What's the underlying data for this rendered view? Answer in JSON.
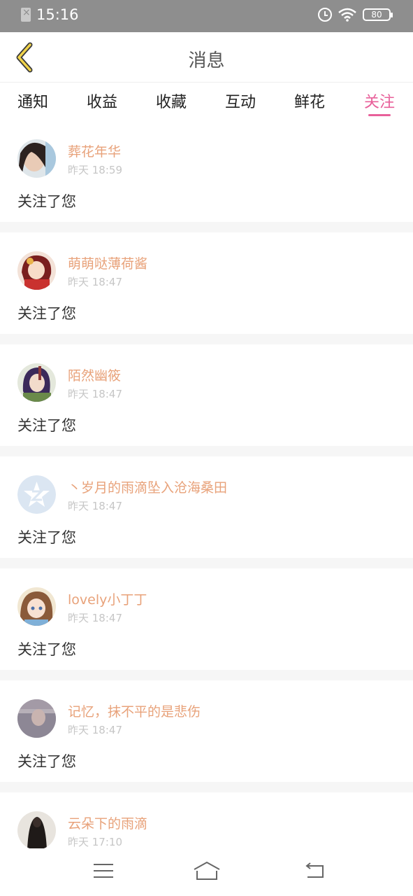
{
  "status_bar": {
    "time": "15:16",
    "battery": "80"
  },
  "header": {
    "title": "消息"
  },
  "tabs": [
    {
      "label": "通知"
    },
    {
      "label": "收益"
    },
    {
      "label": "收藏"
    },
    {
      "label": "互动"
    },
    {
      "label": "鲜花"
    },
    {
      "label": "关注",
      "active": true
    }
  ],
  "messages": [
    {
      "name": "葬花年华",
      "time": "昨天 18:59",
      "text": "关注了您",
      "avatar": "avatar-woman-photo"
    },
    {
      "name": "萌萌哒薄荷酱",
      "time": "昨天 18:47",
      "text": "关注了您",
      "avatar": "avatar-anime-red"
    },
    {
      "name": "陌然幽筱",
      "time": "昨天 18:47",
      "text": "关注了您",
      "avatar": "avatar-anime-purple"
    },
    {
      "name": "丶岁月的雨滴坠入沧海桑田",
      "time": "昨天 18:47",
      "text": "关注了您",
      "avatar": "avatar-default-logo"
    },
    {
      "name": "lovely小丁丁",
      "time": "昨天 18:47",
      "text": "关注了您",
      "avatar": "avatar-anime-girl"
    },
    {
      "name": "记忆，抹不平的是悲伤",
      "time": "昨天 18:47",
      "text": "关注了您",
      "avatar": "avatar-grey-photo"
    },
    {
      "name": "云朵下的雨滴",
      "time": "昨天 17:10",
      "text": "",
      "avatar": "avatar-dark-photo"
    }
  ],
  "colors": {
    "accent": "#e8609a",
    "username": "#e8a27a",
    "status_bar": "#8e8e8e"
  }
}
